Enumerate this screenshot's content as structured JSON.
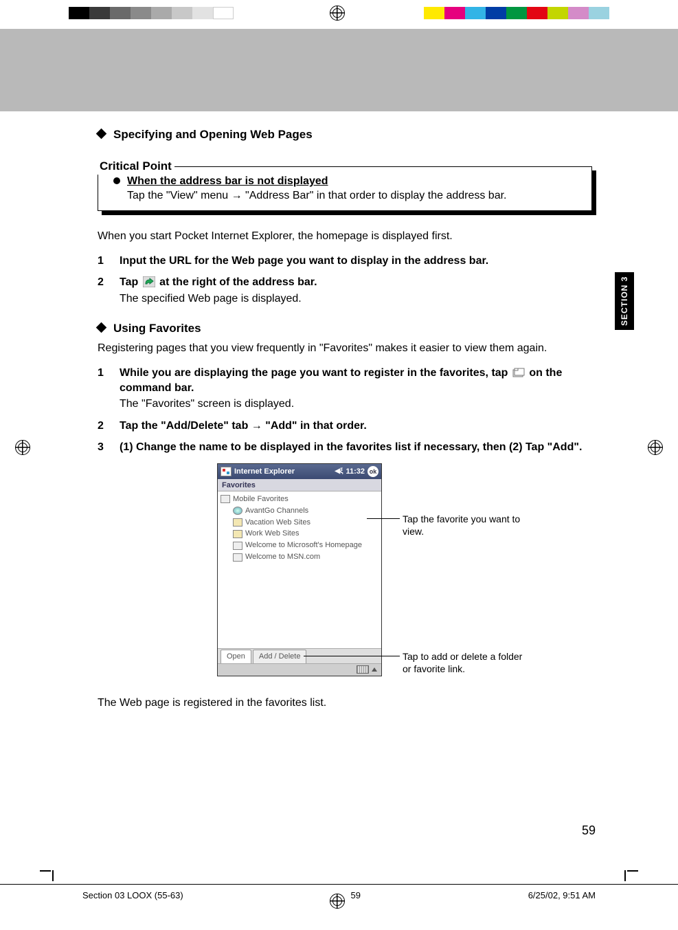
{
  "header": {
    "title1": "Specifying and Opening Web Pages",
    "critical_label": "Critical Point",
    "critical_head": "When the address bar is not displayed",
    "critical_body": "Tap the \"View\" menu → \"Address Bar\" in that order to display the address bar."
  },
  "body": {
    "intro": "When you start Pocket Internet Explorer, the homepage is displayed first.",
    "step1": "Input the URL for the Web page you want to display in the address bar.",
    "step2_a": "Tap",
    "step2_b": "at the right of the address bar.",
    "step2_sub": "The specified Web page is displayed.",
    "title2": "Using Favorites",
    "fav_intro": "Registering pages that you view frequently in \"Favorites\" makes it easier to view them again.",
    "fav_step1_a": "While you are displaying the page you want to register in the favorites, tap",
    "fav_step1_b": "on the command bar.",
    "fav_step1_sub": "The \"Favorites\" screen is displayed.",
    "fav_step2": "Tap the \"Add/Delete\" tab → \"Add\" in that order.",
    "fav_step3": "(1) Change the name to be displayed in the favorites list if necessary, then (2) Tap \"Add\".",
    "outro": "The Web page is registered in the favorites list."
  },
  "pda": {
    "title": "Internet Explorer",
    "time": "11:32",
    "ok": "ok",
    "subtitle": "Favorites",
    "items": [
      {
        "label": "Mobile Favorites",
        "indent": false,
        "icon": "doc"
      },
      {
        "label": "AvantGo Channels",
        "indent": true,
        "icon": "globe"
      },
      {
        "label": "Vacation Web Sites",
        "indent": true,
        "icon": "folder"
      },
      {
        "label": "Work Web Sites",
        "indent": true,
        "icon": "folder"
      },
      {
        "label": "Welcome to Microsoft's Homepage",
        "indent": true,
        "icon": "doc"
      },
      {
        "label": "Welcome to MSN.com",
        "indent": true,
        "icon": "doc"
      }
    ],
    "tab_open": "Open",
    "tab_add": "Add / Delete"
  },
  "callouts": {
    "c1": "Tap the favorite you want to view.",
    "c2": "Tap to add or delete a folder or favorite link."
  },
  "section_tab": "SECTION 3",
  "page_number": "59",
  "footer": {
    "left": "Section 03 LOOX (55-63)",
    "center": "59",
    "right": "6/25/02, 9:51 AM"
  }
}
